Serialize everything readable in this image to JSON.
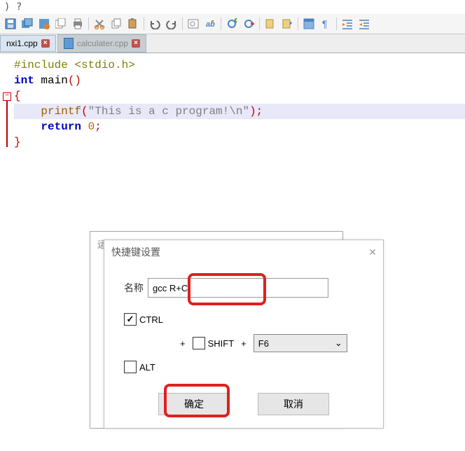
{
  "top_fragment": ") ?",
  "tabs": {
    "active": {
      "name": "nxi1.cpp"
    },
    "inactive": {
      "name": "calculater.cpp"
    }
  },
  "code": {
    "l1a": "#include ",
    "l1b": "<stdio.h>",
    "l2a": "int ",
    "l2b": "main",
    "l2c": "()",
    "l3": "{",
    "l4a": "    printf",
    "l4b": "(",
    "l4c": "\"This is a c program!\\n\"",
    "l4d": ");",
    "l5a": "    return ",
    "l5b": "0",
    "l5c": ";",
    "l6": "}"
  },
  "dialog_back_title": "运…",
  "dialog": {
    "title": "快捷键设置",
    "name_label": "名称",
    "name_value": "gcc R+C",
    "ctrl": {
      "label": "CTRL",
      "checked": true
    },
    "shift": {
      "label": "SHIFT",
      "checked": false
    },
    "alt": {
      "label": "ALT",
      "checked": false
    },
    "plus": "+",
    "key": "F6",
    "ok": "确定",
    "cancel": "取消"
  }
}
